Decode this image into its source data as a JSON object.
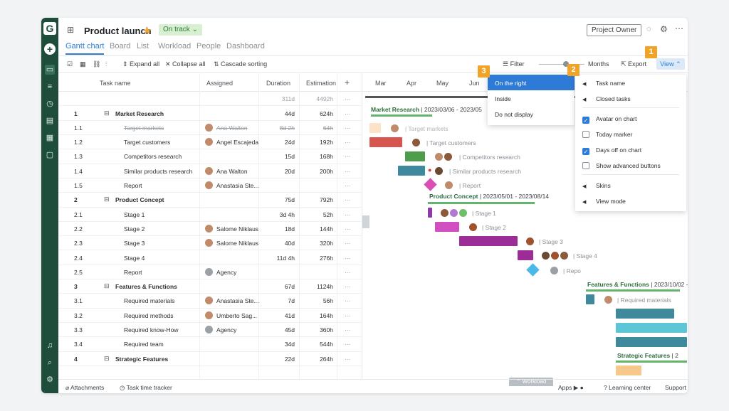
{
  "app": {
    "logo": "G",
    "project_title": "Product launch",
    "status": "On track",
    "owner_label": "Project Owner",
    "colors": {
      "brand": "#1f4d3c",
      "accent": "#2d7bd6",
      "badge": "#f0a326"
    }
  },
  "tabs": [
    "Gantt chart",
    "Board",
    "List",
    "Workload",
    "People",
    "Dashboard"
  ],
  "toolbar": {
    "expand_all": "Expand all",
    "collapse_all": "Collapse all",
    "cascade_sorting": "Cascade sorting",
    "filter": "Filter",
    "months": "Months",
    "export": "Export",
    "view": "View"
  },
  "grid": {
    "headers": {
      "task": "Task name",
      "assigned": "Assigned",
      "duration": "Duration",
      "estimation": "Estimation"
    },
    "totals": {
      "duration": "311d",
      "estimation": "4492h"
    },
    "rows": [
      {
        "num": "1",
        "name": "Market Research",
        "assigned": "",
        "duration": "44d",
        "estimation": "624h",
        "level": 0
      },
      {
        "num": "1.1",
        "name": "Target markets",
        "assigned": "Ana Walton",
        "duration": "8d 2h",
        "estimation": "64h",
        "level": 1,
        "done": true
      },
      {
        "num": "1.2",
        "name": "Target customers",
        "assigned": "Angel Escajeda",
        "duration": "24d",
        "estimation": "192h",
        "level": 1
      },
      {
        "num": "1.3",
        "name": "Competitors research",
        "assigned": "",
        "duration": "15d",
        "estimation": "168h",
        "level": 1
      },
      {
        "num": "1.4",
        "name": "Similar products research",
        "assigned": "Ana Walton",
        "duration": "20d",
        "estimation": "200h",
        "level": 1
      },
      {
        "num": "1.5",
        "name": "Report",
        "assigned": "Anastasia Ste...",
        "duration": "",
        "estimation": "",
        "level": 1
      },
      {
        "num": "2",
        "name": "Product Concept",
        "assigned": "",
        "duration": "75d",
        "estimation": "792h",
        "level": 0
      },
      {
        "num": "2.1",
        "name": "Stage 1",
        "assigned": "",
        "duration": "3d 4h",
        "estimation": "52h",
        "level": 1
      },
      {
        "num": "2.2",
        "name": "Stage 2",
        "assigned": "Salome Niklaus",
        "duration": "18d",
        "estimation": "144h",
        "level": 1
      },
      {
        "num": "2.3",
        "name": "Stage 3",
        "assigned": "Salome Niklaus",
        "duration": "40d",
        "estimation": "320h",
        "level": 1
      },
      {
        "num": "2.4",
        "name": "Stage 4",
        "assigned": "",
        "duration": "11d 4h",
        "estimation": "276h",
        "level": 1
      },
      {
        "num": "2.5",
        "name": "Report",
        "assigned": "Agency",
        "duration": "",
        "estimation": "",
        "level": 1
      },
      {
        "num": "3",
        "name": "Features & Functions",
        "assigned": "",
        "duration": "67d",
        "estimation": "1124h",
        "level": 0
      },
      {
        "num": "3.1",
        "name": "Required materials",
        "assigned": "Anastasia Ste...",
        "duration": "7d",
        "estimation": "56h",
        "level": 1
      },
      {
        "num": "3.2",
        "name": "Required methods",
        "assigned": "Umberto Sag...",
        "duration": "41d",
        "estimation": "164h",
        "level": 1
      },
      {
        "num": "3.3",
        "name": "Required know-How",
        "assigned": "Agency",
        "duration": "45d",
        "estimation": "360h",
        "level": 1
      },
      {
        "num": "3.4",
        "name": "Required team",
        "assigned": "",
        "duration": "34d",
        "estimation": "544h",
        "level": 1
      },
      {
        "num": "4",
        "name": "Strategic Features",
        "assigned": "",
        "duration": "22d",
        "estimation": "264h",
        "level": 0
      }
    ]
  },
  "gantt": {
    "months": [
      "Mar",
      "Apr",
      "May",
      "Jun"
    ],
    "groups": [
      {
        "title": "Market Research",
        "dates": "| 2023/03/06 - 2023/05"
      },
      {
        "title": "Product Concept",
        "dates": "| 2023/05/01 - 2023/08/14"
      },
      {
        "title": "Features & Functions",
        "dates": "| 2023/10/02 - 2"
      },
      {
        "title": "Strategic Features",
        "dates": "| 2"
      }
    ],
    "labels": [
      "Target markets",
      "Target customers",
      "Competitors research",
      "Similar products research",
      "Report",
      "Stage 1",
      "Stage 2",
      "Stage 3",
      "Stage 4",
      "Repo",
      "Required materials"
    ],
    "workload": "Workload"
  },
  "text_position_menu": [
    "On the right",
    "Inside",
    "Do not display"
  ],
  "view_menu": {
    "task_name": "Task name",
    "closed_tasks": "Closed tasks",
    "avatar_on_chart": "Avatar on chart",
    "today_marker": "Today marker",
    "days_off": "Days off on chart",
    "advanced_buttons": "Show advanced buttons",
    "skins": "Skins",
    "view_mode": "View mode"
  },
  "badges": [
    "1",
    "2",
    "3"
  ],
  "footer": {
    "attachments": "Attachments",
    "time_tracker": "Task time tracker",
    "apps": "Apps",
    "learning": "Learning center",
    "support": "Support"
  }
}
